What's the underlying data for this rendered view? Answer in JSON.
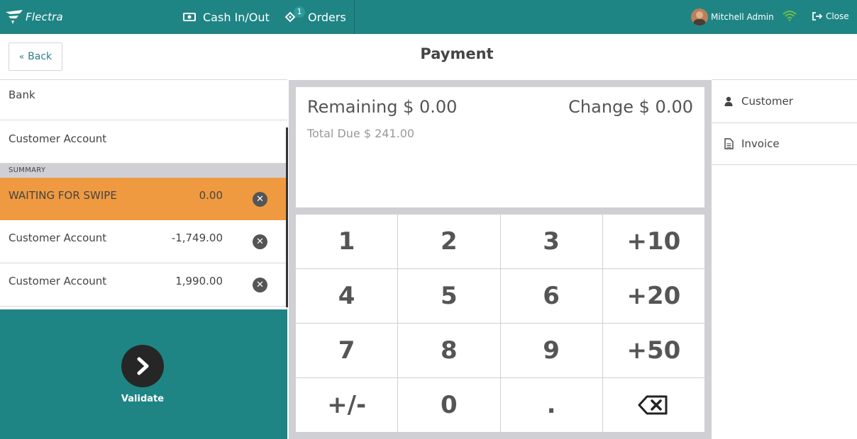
{
  "app": {
    "logo_text": "Flectra"
  },
  "topbar": {
    "cash_label": "Cash In/Out",
    "orders_label": "Orders",
    "orders_badge": "1",
    "user_name": "Mitchell Admin",
    "close_label": "Close"
  },
  "header": {
    "back_label": "Back",
    "title": "Payment"
  },
  "payment_methods": [
    {
      "label": "Bank"
    },
    {
      "label": "Customer Account"
    }
  ],
  "summary": {
    "header": "SUMMARY",
    "lines": [
      {
        "name": "WAITING FOR SWIPE",
        "amount": "0.00",
        "selected": true
      },
      {
        "name": "Customer Account",
        "amount": "-1,749.00",
        "selected": false
      },
      {
        "name": "Customer Account",
        "amount": "1,990.00",
        "selected": false
      }
    ]
  },
  "validate": {
    "label": "Validate"
  },
  "status": {
    "remaining": "Remaining $ 0.00",
    "change": "Change $ 0.00",
    "total_due": "Total Due  $ 241.00"
  },
  "numpad": {
    "keys": [
      "1",
      "2",
      "3",
      "+10",
      "4",
      "5",
      "6",
      "+20",
      "7",
      "8",
      "9",
      "+50",
      "+/-",
      "0",
      ".",
      ""
    ]
  },
  "right_panel": {
    "customer_label": "Customer",
    "invoice_label": "Invoice"
  },
  "colors": {
    "topbar": "#1f8484",
    "selected_line": "#ef9a41",
    "validate_bg": "#1f8484"
  }
}
